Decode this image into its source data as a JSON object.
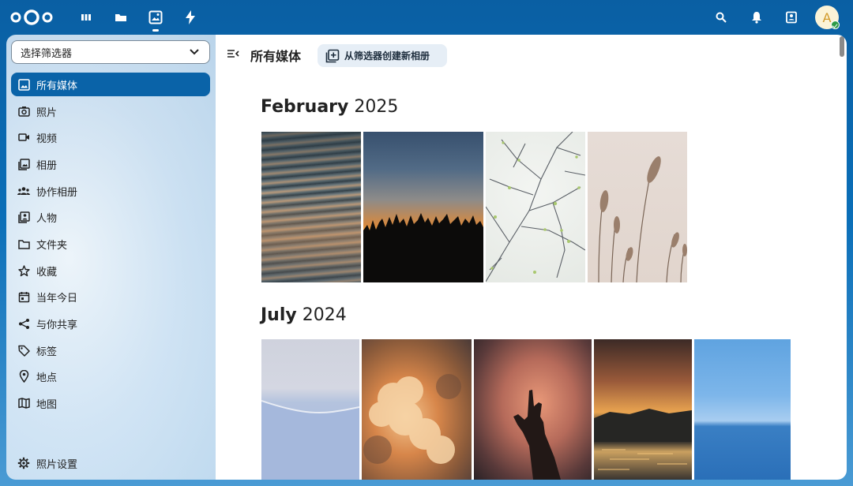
{
  "topbar": {
    "apps": [
      {
        "name": "dashboard",
        "icon": "dashboard-icon"
      },
      {
        "name": "files",
        "icon": "folder-icon"
      },
      {
        "name": "photos",
        "icon": "photos-icon",
        "active": true
      },
      {
        "name": "activity",
        "icon": "lightning-icon"
      }
    ],
    "right_icons": [
      "search-icon",
      "bell-icon",
      "contacts-icon"
    ],
    "avatar_initial": "A"
  },
  "sidebar": {
    "filter_select": "选择筛选器",
    "items": [
      {
        "label": "所有媒体",
        "icon": "image-icon",
        "active": true
      },
      {
        "label": "照片",
        "icon": "camera-icon"
      },
      {
        "label": "视频",
        "icon": "video-icon"
      },
      {
        "label": "相册",
        "icon": "album-icon"
      },
      {
        "label": "协作相册",
        "icon": "people-icon"
      },
      {
        "label": "人物",
        "icon": "person-icon"
      },
      {
        "label": "文件夹",
        "icon": "folder-icon"
      },
      {
        "label": "收藏",
        "icon": "star-icon"
      },
      {
        "label": "当年今日",
        "icon": "calendar-icon"
      },
      {
        "label": "与你共享",
        "icon": "share-icon"
      },
      {
        "label": "标签",
        "icon": "tag-icon"
      },
      {
        "label": "地点",
        "icon": "map-pin-icon"
      },
      {
        "label": "地图",
        "icon": "map-icon"
      }
    ],
    "settings_label": "照片设置"
  },
  "main": {
    "title": "所有媒体",
    "create_button": "从筛选器创建新相册",
    "groups": [
      {
        "month": "February",
        "year": "2025"
      },
      {
        "month": "July",
        "year": "2024"
      }
    ]
  },
  "colors": {
    "brand": "#0a63a8",
    "header_bg": "#0b6fb8",
    "active_text": "#ffffff"
  }
}
